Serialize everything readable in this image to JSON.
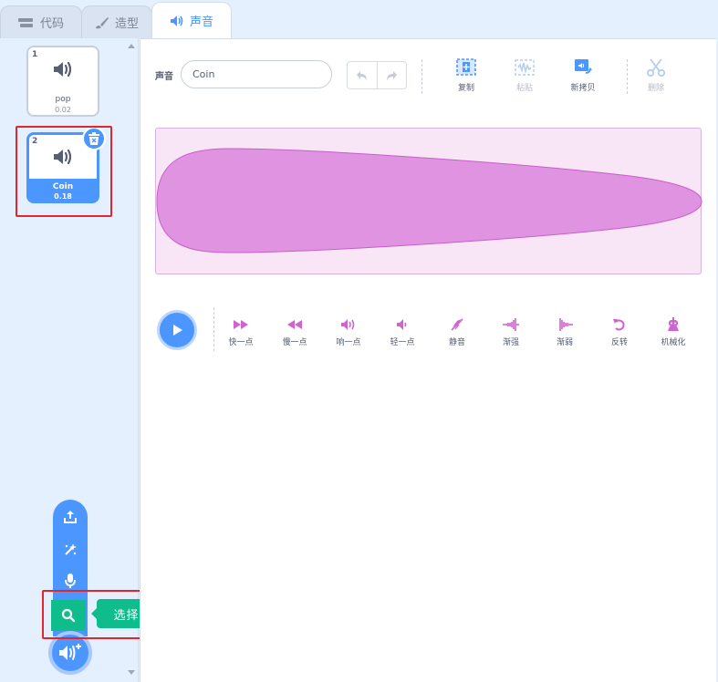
{
  "tabs": [
    {
      "label": "代码",
      "icon": "code-icon"
    },
    {
      "label": "造型",
      "icon": "brush-icon"
    },
    {
      "label": "声音",
      "icon": "speaker-icon"
    }
  ],
  "sounds": [
    {
      "number": "1",
      "name": "pop",
      "duration": "0.02"
    },
    {
      "number": "2",
      "name": "Coin",
      "duration": "0.18"
    }
  ],
  "editor": {
    "sound_label": "声音",
    "sound_name": "Coin",
    "tools": {
      "copy": "复制",
      "paste": "粘贴",
      "copy_to_new": "新拷贝",
      "delete": "删除"
    },
    "effects": [
      {
        "label": "快一点",
        "icon": "faster-icon"
      },
      {
        "label": "慢一点",
        "icon": "slower-icon"
      },
      {
        "label": "响一点",
        "icon": "louder-icon"
      },
      {
        "label": "轻一点",
        "icon": "softer-icon"
      },
      {
        "label": "静音",
        "icon": "mute-icon"
      },
      {
        "label": "渐强",
        "icon": "fade-in-icon"
      },
      {
        "label": "渐弱",
        "icon": "fade-out-icon"
      },
      {
        "label": "反转",
        "icon": "reverse-icon"
      },
      {
        "label": "机械化",
        "icon": "robot-icon"
      }
    ]
  },
  "add_menu": {
    "tooltip": "选择一个声音"
  },
  "colors": {
    "accent": "#4c97ff",
    "green": "#0fbd8c",
    "wave_fill": "#e093e0",
    "highlight": "#e3262b"
  }
}
